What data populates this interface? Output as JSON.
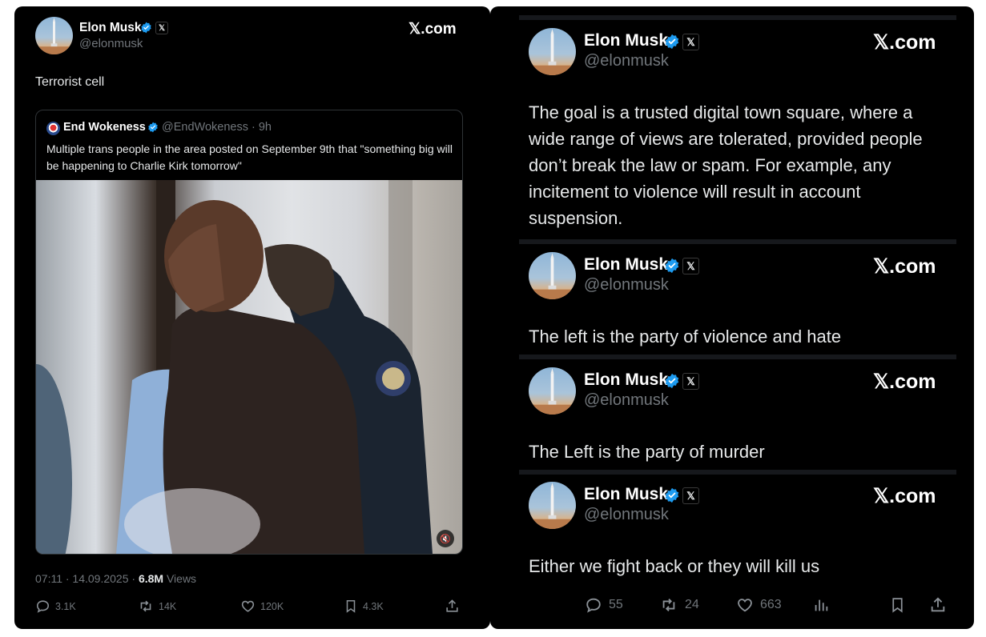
{
  "left": {
    "author": {
      "name": "Elon Musk",
      "handle": "@elonmusk"
    },
    "brand": "𝕏.com",
    "text": "Terrorist cell",
    "quote": {
      "name": "End Wokeness",
      "handle": "@EndWokeness",
      "time": "· 9h",
      "text": "Multiple trans people in the area posted on September 9th that \"something big will be happening to Charlie Kirk tomorrow\""
    },
    "meta": {
      "timestamp": "07:11 · 14.09.2025 · ",
      "views_count": "6.8M",
      "views_label": " Views"
    },
    "actions": {
      "replies": "3.1K",
      "reposts": "14K",
      "likes": "120K",
      "bookmarks": "4.3K"
    }
  },
  "right": {
    "posts": [
      {
        "name": "Elon Musk",
        "handle": "@elonmusk",
        "brand": "𝕏.com",
        "text": "The goal is a trusted digital town square, where a wide range of views are tolerated, provided people don’t break the law or spam. For example, any incitement to violence will result in account suspension."
      },
      {
        "name": "Elon Musk",
        "handle": "@elonmusk",
        "brand": "𝕏.com",
        "text": "The left is the party of violence and hate"
      },
      {
        "name": "Elon Musk",
        "handle": "@elonmusk",
        "brand": "𝕏.com",
        "text": "The Left is the party of murder"
      },
      {
        "name": "Elon Musk",
        "handle": "@elonmusk",
        "brand": "𝕏.com",
        "text": "Either we fight back or they will kill us"
      }
    ],
    "actions": {
      "replies": "55",
      "reposts": "24",
      "likes": "663"
    }
  },
  "colors": {
    "background": "#000000",
    "verified": "#1d9bf0",
    "muted": "#71767b",
    "text": "#e7e9ea"
  },
  "icons": [
    "verified-icon",
    "x-logo-icon",
    "reply-icon",
    "repost-icon",
    "like-icon",
    "bookmark-icon",
    "share-icon",
    "analytics-icon",
    "mute-icon"
  ]
}
